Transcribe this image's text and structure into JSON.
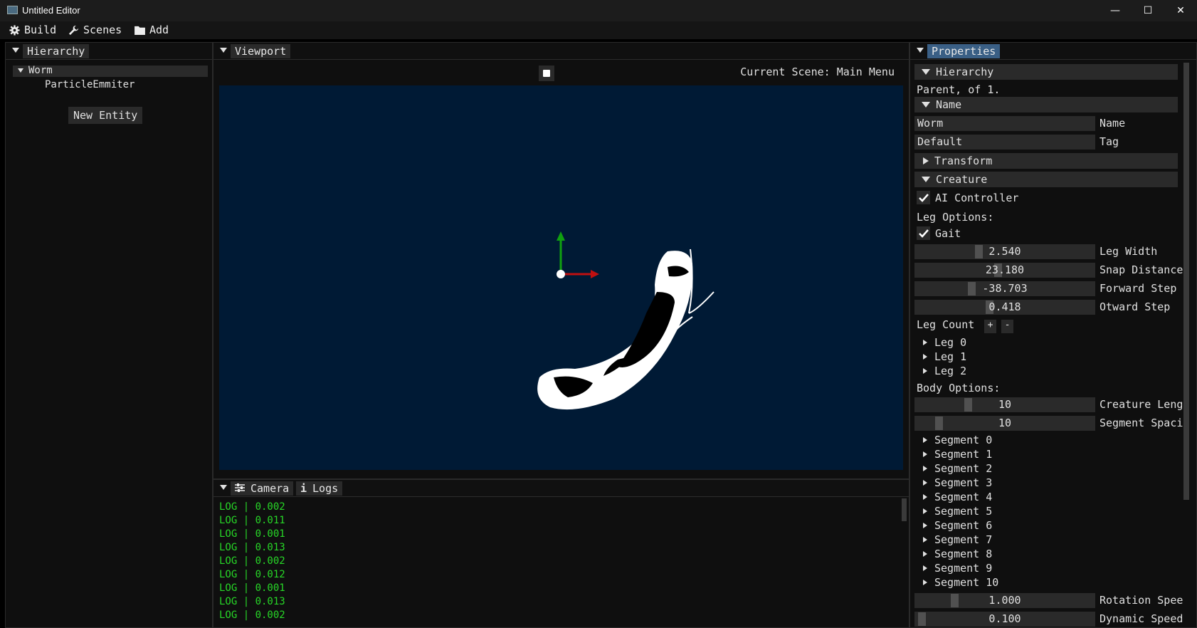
{
  "window": {
    "title": "Untitled Editor",
    "minimize": "—",
    "maximize": "☐",
    "close": "✕"
  },
  "menu": {
    "build": "Build",
    "scenes": "Scenes",
    "add": "Add"
  },
  "hierarchy_panel": {
    "tab": "Hierarchy",
    "root": "Worm",
    "child": "ParticleEmmiter",
    "new_entity": "New Entity"
  },
  "viewport": {
    "tab": "Viewport",
    "current_scene": "Current Scene: Main Menu",
    "background": "#001a35"
  },
  "bottom": {
    "camera_tab": "Camera",
    "logs_tab": "Logs",
    "logs": [
      "LOG | 0.002",
      "LOG | 0.011",
      "LOG | 0.001",
      "LOG | 0.013",
      "LOG | 0.002",
      "LOG | 0.012",
      "LOG | 0.001",
      "LOG | 0.013",
      "LOG | 0.002"
    ]
  },
  "properties": {
    "tab": "Properties",
    "hierarchy_header": "Hierarchy",
    "parent_text": "Parent, of 1.",
    "name_header": "Name",
    "name_value": "Worm",
    "name_label": "Name",
    "tag_value": "Default",
    "tag_label": "Tag",
    "transform_header": "Transform",
    "creature_header": "Creature",
    "ai_controller": "AI Controller",
    "leg_options": "Leg Options:",
    "gait": "Gait",
    "leg_width": {
      "value": "2.540",
      "label": "Leg Width",
      "fraction": 0.35
    },
    "snap_distance": {
      "value": "23.180",
      "label": "Snap Distance",
      "fraction": 0.46
    },
    "forward_step": {
      "value": "-38.703",
      "label": "Forward Step",
      "fraction": 0.31
    },
    "otward_step": {
      "value": "0.418",
      "label": "Otward Step",
      "fraction": 0.41
    },
    "leg_count": "Leg Count",
    "plus": "+",
    "minus": "-",
    "legs": [
      "Leg 0",
      "Leg 1",
      "Leg 2"
    ],
    "body_options": "Body Options:",
    "creature_length": {
      "value": "10",
      "label": "Creature Leng",
      "fraction": 0.29
    },
    "segment_spacing": {
      "value": "10",
      "label": "Segment Spaci",
      "fraction": 0.12
    },
    "segments": [
      "Segment 0",
      "Segment 1",
      "Segment 2",
      "Segment 3",
      "Segment 4",
      "Segment 5",
      "Segment 6",
      "Segment 7",
      "Segment 8",
      "Segment 9",
      "Segment 10"
    ],
    "rotation_speed": {
      "value": "1.000",
      "label": "Rotation Spee",
      "fraction": 0.21
    },
    "dynamic_speed": {
      "value": "0.100",
      "label": "Dynamic Speed",
      "fraction": 0.02
    }
  }
}
